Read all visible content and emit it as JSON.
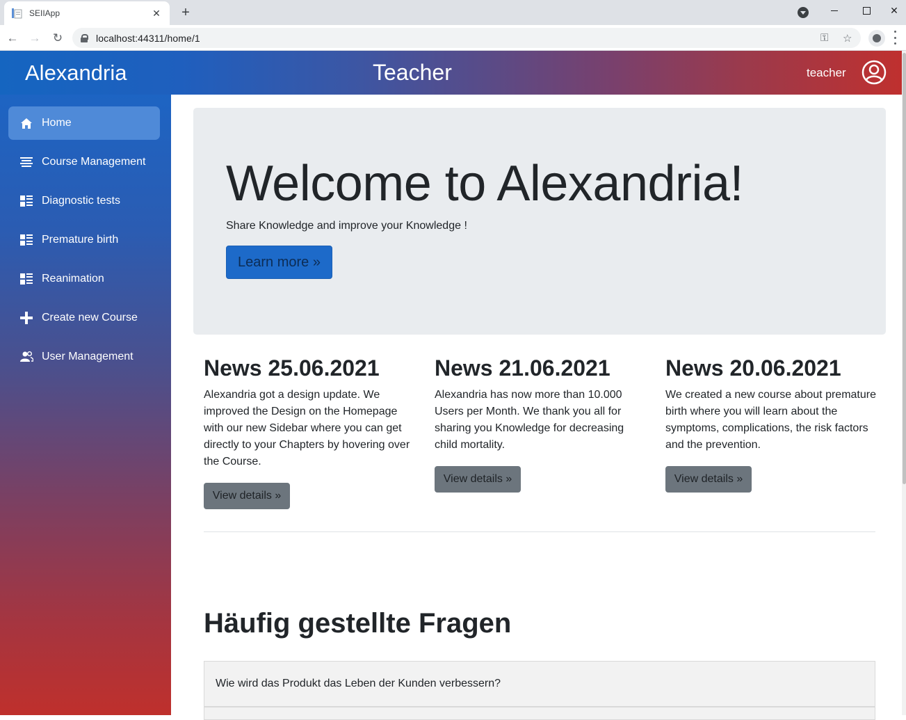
{
  "browser": {
    "tab_title": "SEIIApp",
    "tab_close": "✕",
    "new_tab": "+",
    "url": "localhost:44311/home/1",
    "back": "←",
    "forward": "→",
    "reload": "↻",
    "key_icon": "⚿",
    "star_icon": "☆",
    "close_window": "✕"
  },
  "header": {
    "brand": "Alexandria",
    "role_title": "Teacher",
    "username": "teacher"
  },
  "sidebar": {
    "items": [
      {
        "label": "Home",
        "icon": "home-icon"
      },
      {
        "label": "Course Management",
        "icon": "list-icon"
      },
      {
        "label": "Diagnostic tests",
        "icon": "list-grid-icon"
      },
      {
        "label": "Premature birth",
        "icon": "list-grid-icon"
      },
      {
        "label": "Reanimation",
        "icon": "list-grid-icon"
      },
      {
        "label": "Create new Course",
        "icon": "plus-icon"
      },
      {
        "label": "User Management",
        "icon": "users-icon"
      }
    ]
  },
  "jumbotron": {
    "title": "Welcome to Alexandria!",
    "subtitle": "Share Knowledge and improve your Knowledge !",
    "button": "Learn more »"
  },
  "news": [
    {
      "title": "News 25.06.2021",
      "text": "Alexandria got a design update. We improved the Design on the Homepage with our new Sidebar where you can get directly to your Chapters by hovering over the Course.",
      "button": "View details »"
    },
    {
      "title": "News 21.06.2021",
      "text": "Alexandria has now more than 10.000 Users per Month. We thank you all for sharing you Knowledge for decreasing child mortality.",
      "button": "View details »"
    },
    {
      "title": "News 20.06.2021",
      "text": "We created a new course about premature birth where you will learn about the symptoms, complications, the risk factors and the prevention.",
      "button": "View details »"
    }
  ],
  "faq": {
    "title": "Häufig gestellte Fragen",
    "items": [
      "Wie wird das Produkt das Leben der Kunden verbessern?"
    ]
  },
  "colors": {
    "accent": "#1d6ac9",
    "sidebar_active": "#4f8ad8",
    "secondary_button": "#6c757d",
    "jumbotron_bg": "#e9ecef"
  }
}
